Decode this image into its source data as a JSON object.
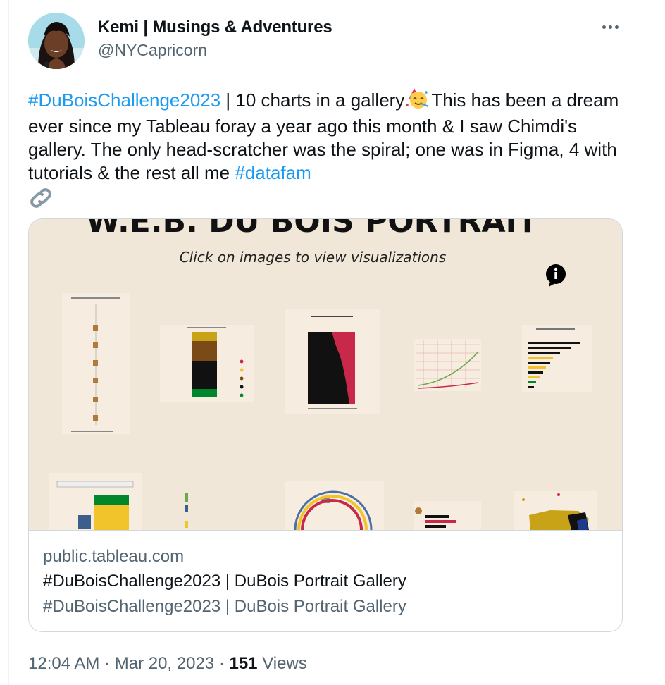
{
  "author": {
    "name": "Kemi | Musings & Adventures",
    "handle": "@NYCapricorn"
  },
  "tweet": {
    "hashtag1": "#DuBoisChallenge2023",
    "text1": " | 10 charts in a gallery",
    "text2": "This has been a dream ever since my Tableau foray a year ago this month & I saw Chimdi's gallery. The only head-scratcher was the spiral; one was in Figma, 4 with tutorials & the rest all me ",
    "hashtag2": "#datafam",
    "emoji": "partying-face-emoji",
    "link_icon": "link-icon"
  },
  "card": {
    "image_title": "W.E.B. DU BOIS PORTRAIT",
    "image_subtitle": "Click on images to view visualizations",
    "info_icon": "info-icon",
    "domain": "public.tableau.com",
    "title": "#DuBoisChallenge2023 | DuBois Portrait Gallery",
    "description": "#DuBoisChallenge2023 | DuBois Portrait Gallery"
  },
  "meta": {
    "time": "12:04 AM",
    "separator1": " · ",
    "date": "Mar 20, 2023",
    "separator2": " · ",
    "views_count": "151",
    "views_label": " Views"
  },
  "colors": {
    "link": "#1d9bf0",
    "secondary_text": "#536471",
    "card_bg": "#f0e7d8",
    "dubois_red": "#c8284a",
    "dubois_yellow": "#f2c42b",
    "dubois_green": "#00872b",
    "dubois_brown": "#7a4b16"
  }
}
